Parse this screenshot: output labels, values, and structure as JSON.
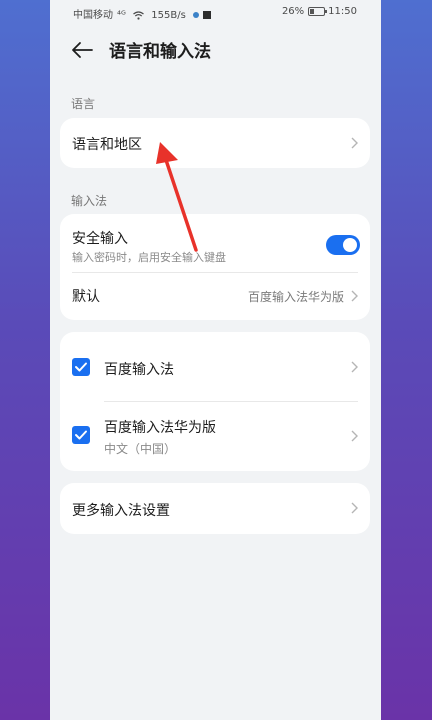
{
  "status_bar": {
    "carrier": "中国移动",
    "signal": "⁴ᴳ",
    "speed": "155B/s",
    "battery_percent": "26%",
    "battery_level": 0.26,
    "time": "11:50"
  },
  "header": {
    "title": "语言和输入法"
  },
  "sections": {
    "language_label": "语言",
    "language_region": "语言和地区",
    "input_label": "输入法",
    "secure_input_title": "安全输入",
    "secure_input_sub": "输入密码时，启用安全输入键盘",
    "secure_input_on": true,
    "default_title": "默认",
    "default_value": "百度输入法华为版",
    "ime1_title": "百度输入法",
    "ime2_title": "百度输入法华为版",
    "ime2_sub": "中文（中国）",
    "more_settings": "更多输入法设置"
  },
  "colors": {
    "accent": "#1a6ff0",
    "background": "#f1f3f5",
    "annotation": "#e8322a"
  }
}
